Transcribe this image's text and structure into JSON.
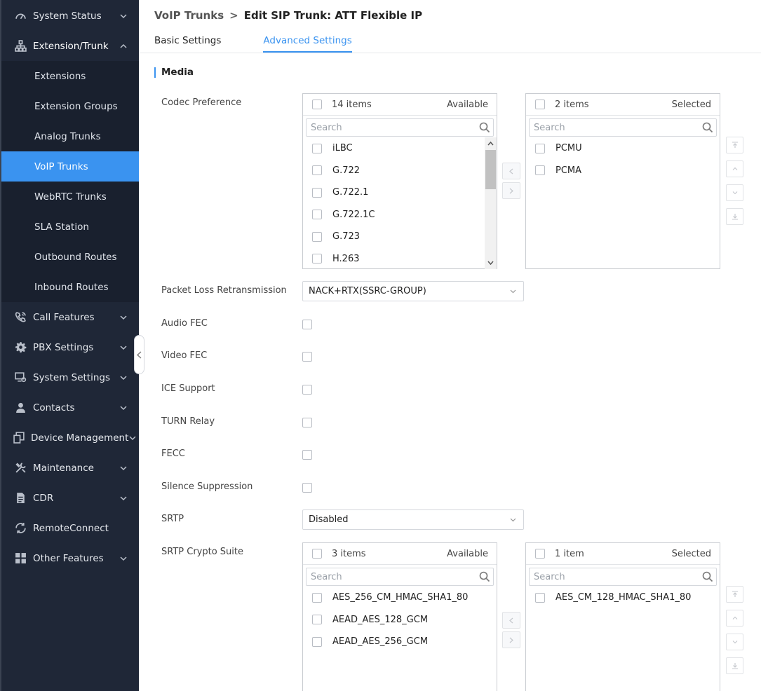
{
  "sidebar": {
    "items": [
      {
        "label": "System Status",
        "icon": "gauge-icon"
      },
      {
        "label": "Extension/Trunk",
        "icon": "network-icon"
      },
      {
        "label": "Call Features",
        "icon": "phone-icon"
      },
      {
        "label": "PBX Settings",
        "icon": "gear-icon"
      },
      {
        "label": "System Settings",
        "icon": "monitor-gear-icon"
      },
      {
        "label": "Contacts",
        "icon": "person-icon"
      },
      {
        "label": "Device Management",
        "icon": "devices-icon"
      },
      {
        "label": "Maintenance",
        "icon": "tools-icon"
      },
      {
        "label": "CDR",
        "icon": "document-icon"
      },
      {
        "label": "RemoteConnect",
        "icon": "remote-connect-icon"
      },
      {
        "label": "Other Features",
        "icon": "grid-icon"
      }
    ],
    "sub_items": [
      "Extensions",
      "Extension Groups",
      "Analog Trunks",
      "VoIP Trunks",
      "WebRTC Trunks",
      "SLA Station",
      "Outbound Routes",
      "Inbound Routes"
    ],
    "active_sub_item": "VoIP Trunks"
  },
  "breadcrumb": {
    "parent": "VoIP Trunks",
    "separator": ">",
    "current": "Edit SIP Trunk: ATT Flexible IP"
  },
  "tabs": [
    {
      "label": "Basic Settings",
      "active": false
    },
    {
      "label": "Advanced Settings",
      "active": true
    }
  ],
  "section": {
    "title": "Media"
  },
  "codec": {
    "label": "Codec Preference",
    "available": {
      "count": "14 items",
      "tag": "Available",
      "search_placeholder": "Search",
      "items": [
        "iLBC",
        "G.722",
        "G.722.1",
        "G.722.1C",
        "G.723",
        "H.263"
      ]
    },
    "selected": {
      "count": "2 items",
      "tag": "Selected",
      "search_placeholder": "Search",
      "items": [
        "PCMU",
        "PCMA"
      ]
    }
  },
  "fields": {
    "packet_loss": {
      "label": "Packet Loss Retransmission",
      "value": "NACK+RTX(SSRC-GROUP)"
    },
    "audio_fec": {
      "label": "Audio FEC"
    },
    "video_fec": {
      "label": "Video FEC"
    },
    "ice_support": {
      "label": "ICE Support"
    },
    "turn_relay": {
      "label": "TURN Relay"
    },
    "fecc": {
      "label": "FECC"
    },
    "silence_suppression": {
      "label": "Silence Suppression"
    },
    "srtp": {
      "label": "SRTP",
      "value": "Disabled"
    }
  },
  "crypto": {
    "label": "SRTP Crypto Suite",
    "available": {
      "count": "3 items",
      "tag": "Available",
      "search_placeholder": "Search",
      "items": [
        "AES_256_CM_HMAC_SHA1_80",
        "AEAD_AES_128_GCM",
        "AEAD_AES_256_GCM"
      ]
    },
    "selected": {
      "count": "1 item",
      "tag": "Selected",
      "search_placeholder": "Search",
      "items": [
        "AES_CM_128_HMAC_SHA1_80"
      ]
    }
  },
  "colors": {
    "accent": "#3a93f0",
    "sidebar_bg": "#1f2737",
    "sidebar_sub_bg": "#19202e"
  }
}
